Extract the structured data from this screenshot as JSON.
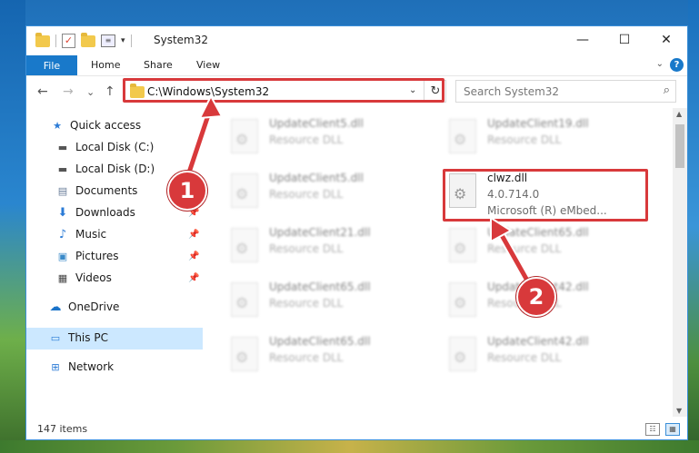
{
  "titlebar": {
    "title": "System32",
    "controls": {
      "minimize": "—",
      "maximize": "☐",
      "close": "✕"
    }
  },
  "ribbon": {
    "tabs": [
      "File",
      "Home",
      "Share",
      "View"
    ],
    "help": "?"
  },
  "navigation": {
    "back": "←",
    "forward": "→",
    "recent": "⌄",
    "up": "↑",
    "address": "C:\\Windows\\System32",
    "search_placeholder": "Search System32"
  },
  "sidebar": {
    "items": [
      {
        "label": "Quick access",
        "icon": "star-icon"
      },
      {
        "label": "Local Disk (C:)",
        "icon": "drive-icon"
      },
      {
        "label": "Local Disk (D:)",
        "icon": "drive-icon"
      },
      {
        "label": "Documents",
        "icon": "documents-icon"
      },
      {
        "label": "Downloads",
        "icon": "download-icon"
      },
      {
        "label": "Music",
        "icon": "music-icon"
      },
      {
        "label": "Pictures",
        "icon": "pictures-icon"
      },
      {
        "label": "Videos",
        "icon": "videos-icon"
      },
      {
        "label": "OneDrive",
        "icon": "cloud-icon"
      },
      {
        "label": "This PC",
        "icon": "computer-icon"
      },
      {
        "label": "Network",
        "icon": "network-icon"
      }
    ],
    "selected": "This PC"
  },
  "files": [
    {
      "name": "UpdateClient5.dll",
      "type": "Resource DLL"
    },
    {
      "name": "UpdateClient19.dll",
      "type": "Resource DLL"
    },
    {
      "name": "UpdateClient5.dll",
      "type": "Resource DLL"
    },
    {
      "name": "clwz.dll",
      "type": "4.0.714.0",
      "desc": "Microsoft (R) eMbed..."
    },
    {
      "name": "UpdateClient21.dll",
      "type": "Resource DLL"
    },
    {
      "name": "UpdateClient65.dll",
      "type": "Resource DLL"
    },
    {
      "name": "UpdateClient65.dll",
      "type": "Resource DLL"
    },
    {
      "name": "UpdateClient42.dll",
      "type": "Resource DLL"
    },
    {
      "name": "UpdateClient65.dll",
      "type": "Resource DLL"
    },
    {
      "name": "UpdateClient42.dll",
      "type": "Resource DLL"
    }
  ],
  "status": {
    "count": "147 items"
  },
  "annotations": {
    "badge1": "1",
    "badge2": "2",
    "color": "#d8393b"
  }
}
